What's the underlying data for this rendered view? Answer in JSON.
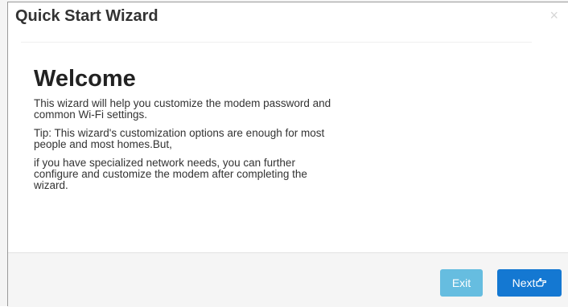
{
  "dialog": {
    "title": "Quick Start Wizard",
    "close_symbol": "×"
  },
  "body": {
    "heading": "Welcome",
    "paragraphs": [
      "This wizard will help you customize the modem password and common Wi-Fi settings.",
      "Tip: This wizard's customization options are enough for most people and most homes.But,",
      "if you have specialized network needs, you can further configure and customize the modem after completing the wizard."
    ]
  },
  "footer": {
    "exit_label": "Exit",
    "next_label": "Next",
    "next_icon": "hand-point-right-icon"
  },
  "colors": {
    "exit_button": "#66bde0",
    "next_button": "#1478d2",
    "footer_background": "#f5f5f5"
  }
}
